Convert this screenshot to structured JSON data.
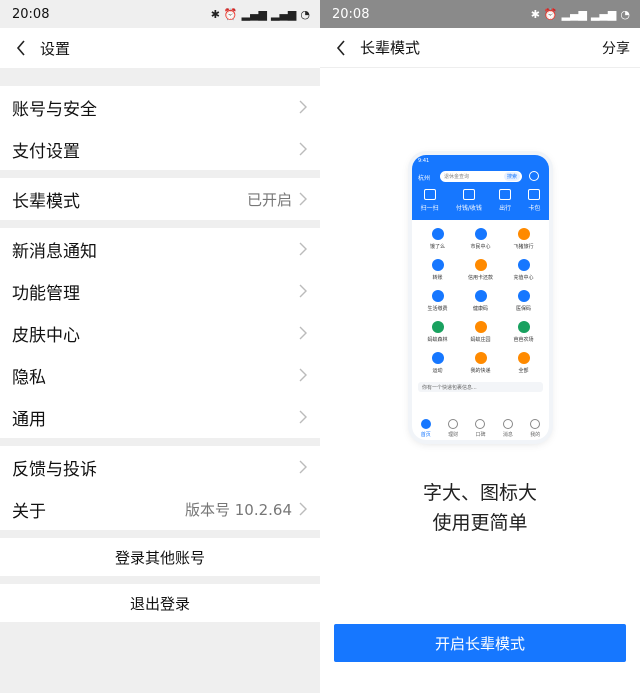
{
  "left": {
    "status": {
      "time": "20:08"
    },
    "nav": {
      "title": "设置"
    },
    "group1": [
      {
        "label": "账号与安全"
      },
      {
        "label": "支付设置"
      }
    ],
    "group2": [
      {
        "label": "长辈模式",
        "value": "已开启"
      }
    ],
    "group3": [
      {
        "label": "新消息通知"
      },
      {
        "label": "功能管理"
      },
      {
        "label": "皮肤中心"
      },
      {
        "label": "隐私"
      },
      {
        "label": "通用"
      }
    ],
    "group4": [
      {
        "label": "反馈与投诉"
      },
      {
        "label": "关于",
        "value": "版本号 10.2.64"
      }
    ],
    "login_other": "登录其他账号",
    "logout": "退出登录"
  },
  "right": {
    "status": {
      "time": "20:08"
    },
    "nav": {
      "title": "长辈模式",
      "share": "分享"
    },
    "preview": {
      "time": "9:41",
      "city": "杭州",
      "search_placeholder": "退休金查询",
      "search_button": "搜索",
      "quick": [
        "扫一扫",
        "付钱/收钱",
        "出行",
        "卡包"
      ],
      "grid": [
        "饿了么",
        "市民中心",
        "飞猪旅行",
        "转账",
        "信用卡还款",
        "充值中心",
        "生活缴费",
        "健康码",
        "医保码",
        "蚂蚁森林",
        "蚂蚁庄园",
        "芭芭农场",
        "运动",
        "我的快递",
        "全部"
      ],
      "banner": "你有一个快递包裹信息...",
      "tabs": [
        "首页",
        "理财",
        "口碑",
        "消息",
        "我的"
      ]
    },
    "tagline1": "字大、图标大",
    "tagline2": "使用更简单",
    "cta": "开启长辈模式"
  },
  "colors": {
    "accent": "#1677ff",
    "page_bg": "#efefef"
  }
}
